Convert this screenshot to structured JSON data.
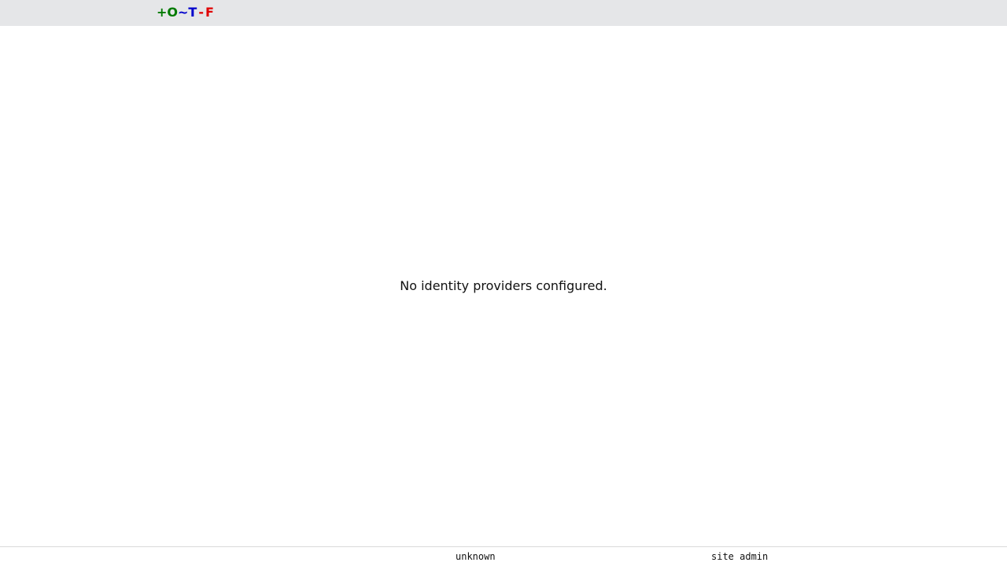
{
  "header": {
    "logo": {
      "parts": [
        {
          "text": "+",
          "color": "#007a00"
        },
        {
          "text": "O",
          "color": "#007a00"
        },
        {
          "text": "~",
          "color": "#0000cc"
        },
        {
          "text": "T",
          "color": "#0000cc"
        },
        {
          "text": "-",
          "color": "#e00000"
        },
        {
          "text": "F",
          "color": "#e00000"
        }
      ]
    }
  },
  "main": {
    "empty_message": "No identity providers configured."
  },
  "footer": {
    "user": "unknown",
    "role": "site admin"
  }
}
